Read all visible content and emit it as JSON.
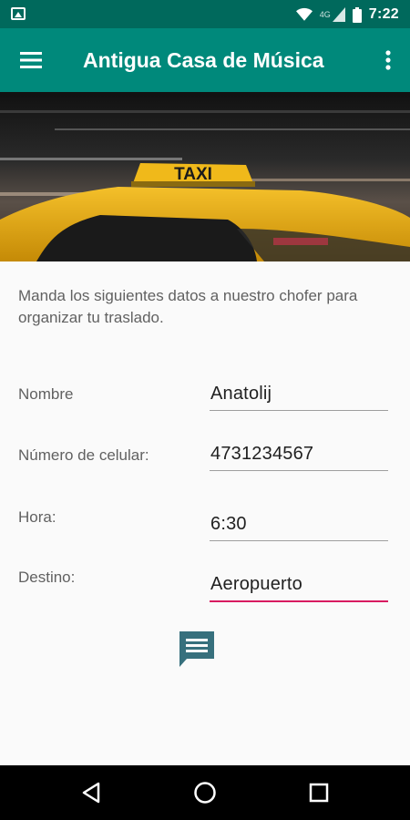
{
  "status_bar": {
    "network_label": "4G",
    "time": "7:22"
  },
  "app_bar": {
    "title": "Antigua Casa de Música",
    "menu_icon": "hamburger-menu-icon",
    "more_icon": "more-vert-icon"
  },
  "hero": {
    "sign_text": "TAXI"
  },
  "form": {
    "intro": "Manda los siguientes datos a nuestro chofer para organizar tu traslado.",
    "fields": [
      {
        "label": "Nombre",
        "value": "Anatolij"
      },
      {
        "label": "Número de celular:",
        "value": "4731234567"
      },
      {
        "label": "Hora:",
        "value": "6:30"
      },
      {
        "label": "Destino:",
        "value": "Aeropuerto"
      }
    ],
    "send_icon": "message-icon"
  },
  "colors": {
    "status_bar": "#00695c",
    "app_bar": "#00897b",
    "active_underline": "#d81b60",
    "send_icon": "#37707d"
  }
}
